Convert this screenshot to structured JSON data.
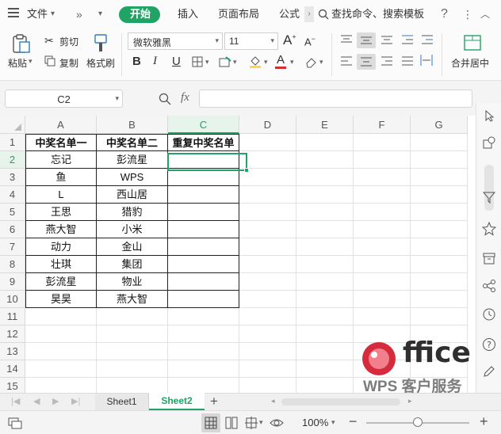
{
  "menubar": {
    "file_label": "文件",
    "tabs": [
      {
        "label": "开始",
        "active": true
      },
      {
        "label": "插入"
      },
      {
        "label": "页面布局"
      },
      {
        "label": "公式"
      }
    ],
    "search_label": "查找命令、搜索模板",
    "help_glyph": "?"
  },
  "ribbon": {
    "paste_label": "粘贴",
    "cut_label": "剪切",
    "copy_label": "复制",
    "format_painter_label": "格式刷",
    "font_name": "微软雅黑",
    "font_size": "11",
    "bold_glyph": "B",
    "italic_glyph": "I",
    "underline_glyph": "U",
    "font_color_glyph": "A",
    "merge_center_label": "合并居中",
    "font_color": "#d32f2f",
    "fill_color": "#ffd54f"
  },
  "formula": {
    "name_box": "C2",
    "fx_label": "fx",
    "value": ""
  },
  "sheet": {
    "columns": [
      "A",
      "B",
      "C",
      "D",
      "E",
      "F",
      "G"
    ],
    "rows": [
      "1",
      "2",
      "3",
      "4",
      "5",
      "6",
      "7",
      "8",
      "9",
      "10",
      "11",
      "12",
      "13",
      "14",
      "15"
    ],
    "header_row": [
      "中奖名单一",
      "中奖名单二",
      "重复中奖名单"
    ],
    "data": [
      [
        "忘记",
        "彭流星",
        ""
      ],
      [
        "鱼",
        "WPS",
        ""
      ],
      [
        "L",
        "西山居",
        ""
      ],
      [
        "王思",
        "猎豹",
        ""
      ],
      [
        "燕大智",
        "小米",
        ""
      ],
      [
        "动力",
        "金山",
        ""
      ],
      [
        "壮琪",
        "集团",
        ""
      ],
      [
        "彭流星",
        "物业",
        ""
      ],
      [
        "昊昊",
        "燕大智",
        ""
      ]
    ],
    "selected_cell": "C2",
    "accent_color": "#21a366"
  },
  "sheet_tabs": {
    "tabs": [
      {
        "label": "Sheet1",
        "active": false
      },
      {
        "label": "Sheet2",
        "active": true
      }
    ],
    "add_glyph": "+"
  },
  "watermark": {
    "brand": "ffice",
    "subtitle": "WPS 客户服务"
  },
  "status": {
    "zoom": "100%",
    "zoom_level": 0.5
  }
}
